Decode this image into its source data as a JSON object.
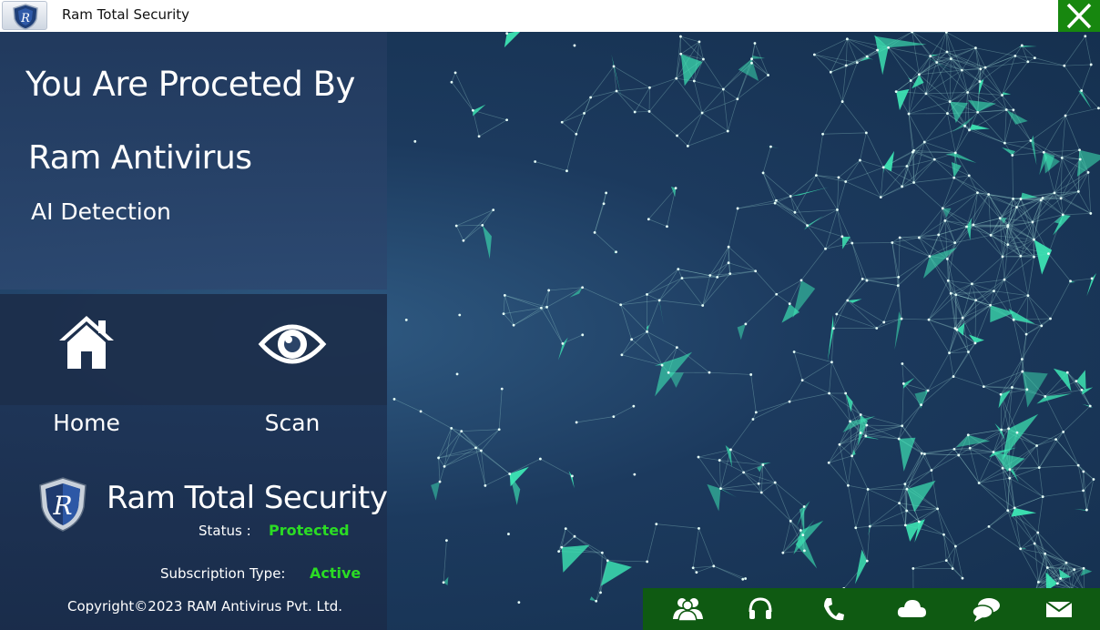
{
  "window": {
    "title": "Ram Total Security"
  },
  "hero": {
    "headline": "You Are Proceted By",
    "product": "Ram Antivirus",
    "feature": "AI Detection"
  },
  "nav": {
    "home_label": "Home",
    "scan_label": "Scan"
  },
  "brand": {
    "name": "Ram Total Security",
    "status_label": "Status :",
    "status_value": "Protected",
    "subscription_label": "Subscription Type:",
    "subscription_value": "Active",
    "copyright": "Copyright©2023 RAM Antivirus Pvt. Ltd."
  },
  "toolbar": {
    "items": [
      "users-icon",
      "headset-icon",
      "phone-icon",
      "cloud-icon",
      "chat-icon",
      "mail-icon"
    ]
  },
  "colors": {
    "accent_green": "#2bdc24",
    "toolbar_bg": "#0f5a12",
    "close_bg": "#17870f",
    "network": "#3ee8b5"
  }
}
